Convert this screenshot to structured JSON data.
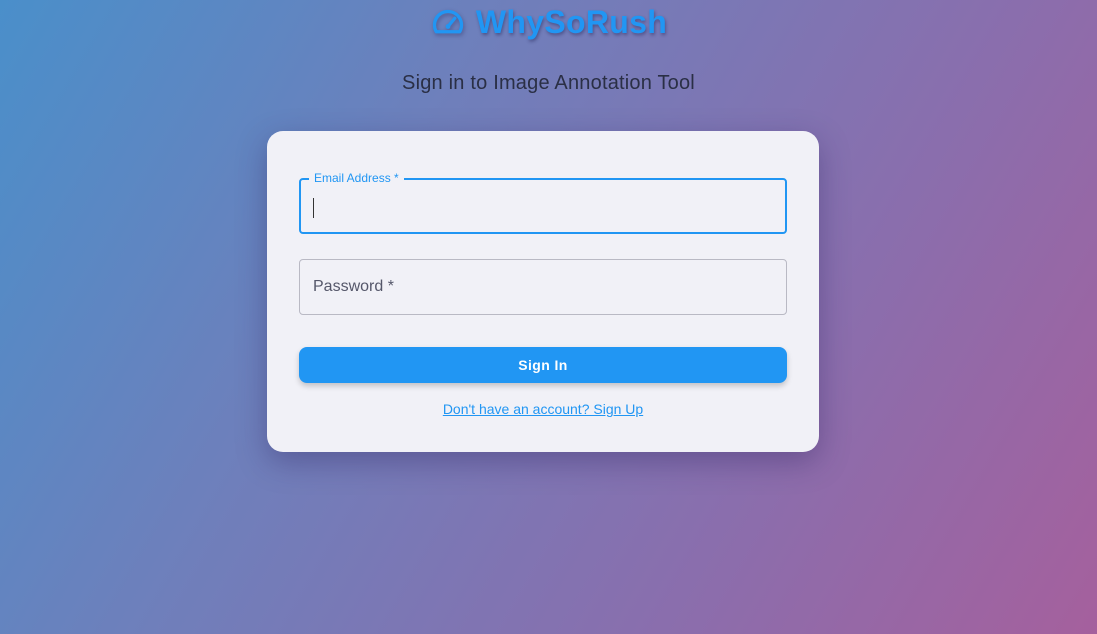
{
  "brand": {
    "name": "WhySoRush",
    "icon": "speedometer-icon",
    "color": "#2196f3"
  },
  "subtitle": "Sign in to Image Annotation Tool",
  "form": {
    "email_label": "Email Address *",
    "email_value": "",
    "password_label": "Password *",
    "password_value": "",
    "submit_label": "Sign In",
    "signup_link": "Don't have an account? Sign Up"
  },
  "colors": {
    "accent": "#2196f3",
    "card_background": "#f1f1f7"
  }
}
